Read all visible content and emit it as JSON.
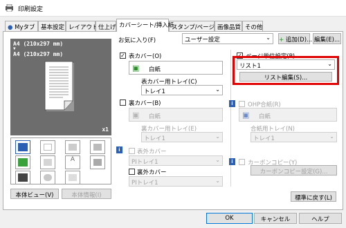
{
  "window": {
    "title": "印刷設定"
  },
  "tabs": [
    {
      "label": "Myタブ"
    },
    {
      "label": "基本設定"
    },
    {
      "label": "レイアウト"
    },
    {
      "label": "仕上げ"
    },
    {
      "label": "カバーシート/挿入紙"
    },
    {
      "label": "スタンプ/ページ印字"
    },
    {
      "label": "画像品質"
    },
    {
      "label": "その他"
    }
  ],
  "favorites": {
    "label": "お気に入り(F)",
    "value": "ユーザー設定",
    "add": "追加(D)...",
    "edit": "編集(E)..."
  },
  "preview": {
    "line1": "A4 (210x297 mm)",
    "arrow": "▼",
    "line2": "A4 (210x297 mm)",
    "copies": "x1"
  },
  "buttons": {
    "printer_view": "本体ビュー(V)",
    "printer_info": "本体情報(I)",
    "restore": "標準に戻す(L)",
    "ok": "OK",
    "cancel": "キャンセル",
    "help": "ヘルプ"
  },
  "front_cover": {
    "label": "表カバー(O)",
    "paper": "白紙",
    "tray_label": "表カバー用トレイ(C)",
    "tray": "トレイ1"
  },
  "back_cover": {
    "label": "裏カバー(B)",
    "paper": "白紙",
    "tray_label": "裏カバー用トレイ(E)",
    "tray": "トレイ1"
  },
  "front_outer": {
    "label": "表外カバー",
    "tray": "PIトレイ1"
  },
  "back_outer": {
    "label": "裏外カバー",
    "tray": "PIトレイ1"
  },
  "per_page": {
    "label": "ページ単位設定(P)",
    "value": "リスト1",
    "edit": "リスト編集(S)..."
  },
  "ohp": {
    "label": "OHP合紙(R)",
    "paper": "白紙",
    "tray_label": "合紙用トレイ(N)",
    "tray": "トレイ1"
  },
  "carbon": {
    "label": "カーボンコピー(Y)",
    "button": "カーボンコピー設定(G)..."
  },
  "colors": {
    "highlight": "#e00000",
    "accent": "#0078d7"
  }
}
